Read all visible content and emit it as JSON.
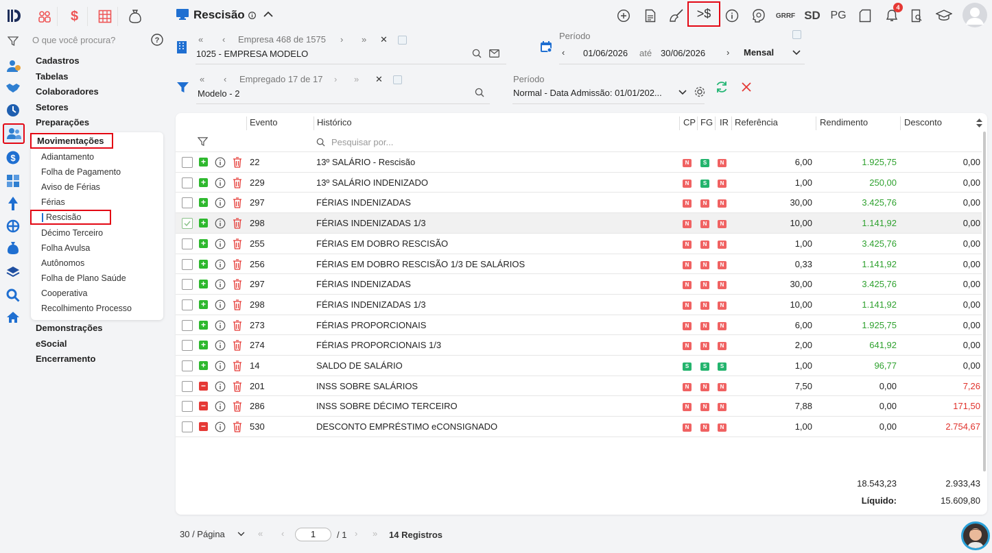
{
  "search": {
    "placeholder": "O que você procura?"
  },
  "menu": {
    "main_top": [
      "Cadastros",
      "Tabelas",
      "Colaboradores",
      "Setores",
      "Preparações"
    ],
    "active": "Movimentações",
    "sub": [
      "Adiantamento",
      "Folha de Pagamento",
      "Aviso de Férias",
      "Férias",
      "Rescisão",
      "Décimo Terceiro",
      "Folha Avulsa",
      "Autônomos",
      "Folha de Plano Saúde",
      "Cooperativa",
      "Recolhimento Processo"
    ],
    "main_bottom": [
      "Demonstrações",
      "eSocial",
      "Encerramento"
    ]
  },
  "header": {
    "title": "Rescisão",
    "toolbar_text": {
      "grrf": "GRRF",
      "sd": "SD",
      "pg": "PG"
    },
    "notification_count": "4"
  },
  "empresa": {
    "nav": "Empresa 468 de 1575",
    "value": "1025 - EMPRESA MODELO"
  },
  "periodo1": {
    "label": "Período",
    "start": "01/06/2026",
    "ate": "até",
    "end": "30/06/2026",
    "type": "Mensal"
  },
  "empregado": {
    "nav": "Empregado 17 de 17",
    "value": "Modelo - 2"
  },
  "periodo2": {
    "label": "Período",
    "value": "Normal - Data Admissão: 01/01/202..."
  },
  "table": {
    "headers": {
      "evento": "Evento",
      "historico": "Histórico",
      "cp": "CP",
      "fg": "FG",
      "ir": "IR",
      "referencia": "Referência",
      "rendimento": "Rendimento",
      "desconto": "Desconto"
    },
    "search_placeholder": "Pesquisar por...",
    "rows": [
      {
        "sign": "+",
        "evento": "22",
        "historico": "13º SALÁRIO - Rescisão",
        "cp": "N",
        "fg": "S",
        "ir": "N",
        "referencia": "6,00",
        "rendimento": "1.925,75",
        "desconto": "0,00"
      },
      {
        "sign": "+",
        "evento": "229",
        "historico": "13º SALÁRIO INDENIZADO",
        "cp": "N",
        "fg": "S",
        "ir": "N",
        "referencia": "1,00",
        "rendimento": "250,00",
        "desconto": "0,00"
      },
      {
        "sign": "+",
        "evento": "297",
        "historico": "FÉRIAS INDENIZADAS",
        "cp": "N",
        "fg": "N",
        "ir": "N",
        "referencia": "30,00",
        "rendimento": "3.425,76",
        "desconto": "0,00"
      },
      {
        "sign": "+",
        "evento": "298",
        "historico": "FÉRIAS INDENIZADAS 1/3",
        "cp": "N",
        "fg": "N",
        "ir": "N",
        "referencia": "10,00",
        "rendimento": "1.141,92",
        "desconto": "0,00",
        "selected": true
      },
      {
        "sign": "+",
        "evento": "255",
        "historico": "FÉRIAS EM DOBRO RESCISÃO",
        "cp": "N",
        "fg": "N",
        "ir": "N",
        "referencia": "1,00",
        "rendimento": "3.425,76",
        "desconto": "0,00"
      },
      {
        "sign": "+",
        "evento": "256",
        "historico": "FÉRIAS EM DOBRO RESCISÃO 1/3 DE SALÁRIOS",
        "cp": "N",
        "fg": "N",
        "ir": "N",
        "referencia": "0,33",
        "rendimento": "1.141,92",
        "desconto": "0,00"
      },
      {
        "sign": "+",
        "evento": "297",
        "historico": "FÉRIAS INDENIZADAS",
        "cp": "N",
        "fg": "N",
        "ir": "N",
        "referencia": "30,00",
        "rendimento": "3.425,76",
        "desconto": "0,00"
      },
      {
        "sign": "+",
        "evento": "298",
        "historico": "FÉRIAS INDENIZADAS 1/3",
        "cp": "N",
        "fg": "N",
        "ir": "N",
        "referencia": "10,00",
        "rendimento": "1.141,92",
        "desconto": "0,00"
      },
      {
        "sign": "+",
        "evento": "273",
        "historico": "FÉRIAS PROPORCIONAIS",
        "cp": "N",
        "fg": "N",
        "ir": "N",
        "referencia": "6,00",
        "rendimento": "1.925,75",
        "desconto": "0,00"
      },
      {
        "sign": "+",
        "evento": "274",
        "historico": "FÉRIAS PROPORCIONAIS 1/3",
        "cp": "N",
        "fg": "N",
        "ir": "N",
        "referencia": "2,00",
        "rendimento": "641,92",
        "desconto": "0,00"
      },
      {
        "sign": "+",
        "evento": "14",
        "historico": "SALDO DE SALÁRIO",
        "cp": "S",
        "fg": "S",
        "ir": "S",
        "referencia": "1,00",
        "rendimento": "96,77",
        "desconto": "0,00"
      },
      {
        "sign": "-",
        "evento": "201",
        "historico": "INSS SOBRE SALÁRIOS",
        "cp": "N",
        "fg": "N",
        "ir": "N",
        "referencia": "7,50",
        "rendimento": "0,00",
        "desconto": "7,26"
      },
      {
        "sign": "-",
        "evento": "286",
        "historico": "INSS SOBRE DÉCIMO TERCEIRO",
        "cp": "N",
        "fg": "N",
        "ir": "N",
        "referencia": "7,88",
        "rendimento": "0,00",
        "desconto": "171,50"
      },
      {
        "sign": "-",
        "evento": "530",
        "historico": "DESCONTO EMPRÉSTIMO eCONSIGNADO",
        "cp": "N",
        "fg": "N",
        "ir": "N",
        "referencia": "1,00",
        "rendimento": "0,00",
        "desconto": "2.754,67"
      }
    ],
    "totals": {
      "rendimento": "18.543,23",
      "desconto": "2.933,43",
      "liquido_label": "Líquido:",
      "liquido": "15.609,80"
    }
  },
  "pagination": {
    "per_page": "30 / Página",
    "page": "1",
    "of": "/ 1",
    "registros": "14 Registros"
  }
}
